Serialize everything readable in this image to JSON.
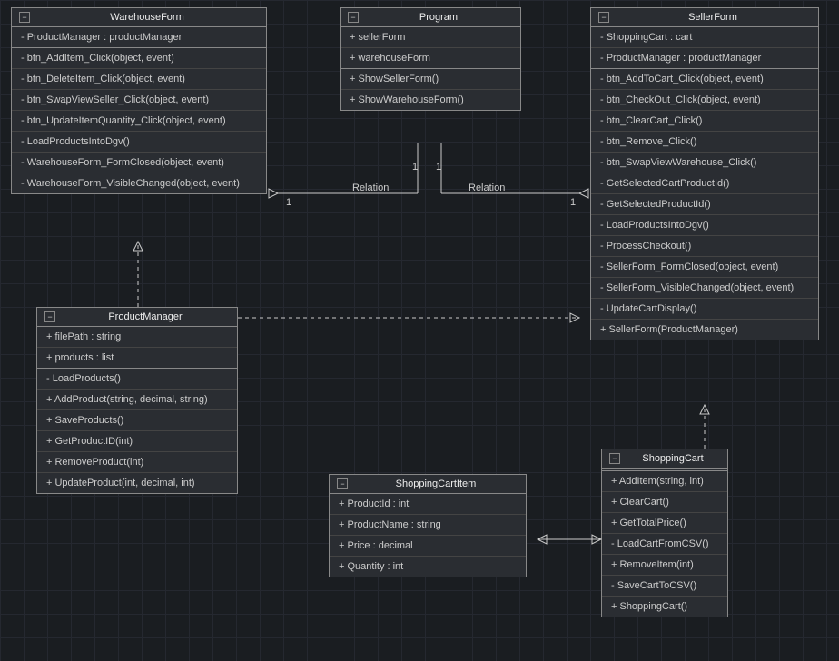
{
  "WarehouseForm": {
    "name": "WarehouseForm",
    "attrs": [
      "- ProductManager : productManager"
    ],
    "methods": [
      "- btn_AddItem_Click(object, event)",
      "- btn_DeleteItem_Click(object, event)",
      "- btn_SwapViewSeller_Click(object, event)",
      "- btn_UpdateItemQuantity_Click(object, event)",
      "- LoadProductsIntoDgv()",
      "- WarehouseForm_FormClosed(object, event)",
      "- WarehouseForm_VisibleChanged(object, event)"
    ]
  },
  "Program": {
    "name": "Program",
    "attrs": [
      "+ sellerForm",
      "+ warehouseForm"
    ],
    "methods": [
      "+ ShowSellerForm()",
      "+ ShowWarehouseForm()"
    ]
  },
  "SellerForm": {
    "name": "SellerForm",
    "attrs": [
      "- ShoppingCart : cart",
      "- ProductManager : productManager"
    ],
    "methods": [
      "- btn_AddToCart_Click(object, event)",
      "- btn_CheckOut_Click(object, event)",
      "- btn_ClearCart_Click()",
      "- btn_Remove_Click()",
      "- btn_SwapViewWarehouse_Click()",
      "- GetSelectedCartProductId()",
      "- GetSelectedProductId()",
      "- LoadProductsIntoDgv()",
      "- ProcessCheckout()",
      "- SellerForm_FormClosed(object, event)",
      "- SellerForm_VisibleChanged(object, event)",
      "- UpdateCartDisplay()",
      "+ SellerForm(ProductManager)"
    ]
  },
  "ProductManager": {
    "name": "ProductManager",
    "attrs": [
      "+ filePath : string",
      "+ products : list"
    ],
    "methods": [
      "- LoadProducts()",
      "+ AddProduct(string, decimal, string)",
      "+ SaveProducts()",
      "+ GetProductID(int)",
      "+ RemoveProduct(int)",
      "+ UpdateProduct(int, decimal, int)"
    ]
  },
  "ShoppingCartItem": {
    "name": "ShoppingCartItem",
    "attrs": [
      "+ ProductId : int",
      "+ ProductName : string",
      "+ Price : decimal",
      "+ Quantity : int"
    ]
  },
  "ShoppingCart": {
    "name": "ShoppingCart",
    "methods": [
      "+ AddItem(string, int)",
      "+ ClearCart()",
      "+ GetTotalPrice()",
      "- LoadCartFromCSV()",
      "+ RemoveItem(int)",
      "- SaveCartToCSV()",
      "+ ShoppingCart()"
    ]
  },
  "labels": {
    "relation1": "Relation",
    "relation2": "Relation",
    "one_a": "1",
    "one_b": "1",
    "one_c": "1",
    "one_d": "1"
  }
}
